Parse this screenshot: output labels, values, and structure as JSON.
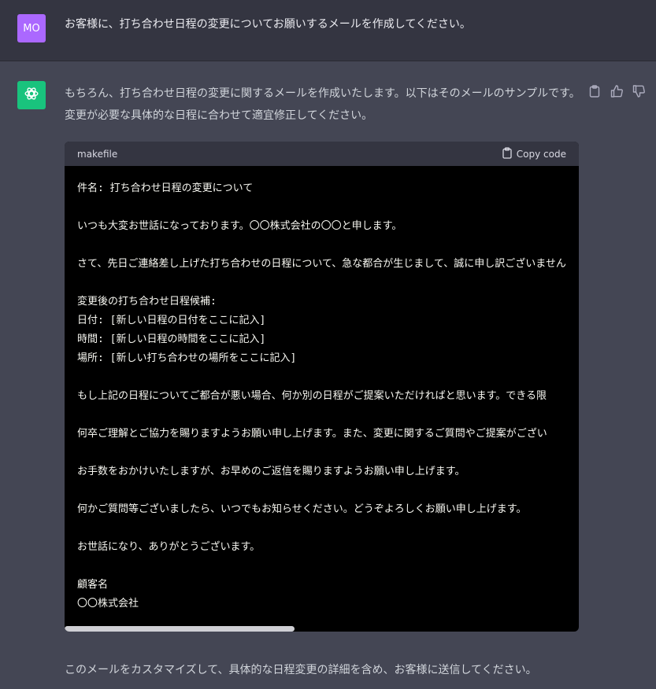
{
  "user": {
    "avatar_initials": "MO",
    "avatar_color": "#ab68ff",
    "message": "お客様に、打ち合わせ日程の変更についてお願いするメールを作成してください。"
  },
  "assistant": {
    "avatar_icon": "openai-logo-icon",
    "avatar_color": "#19c37d",
    "intro": "もちろん、打ち合わせ日程の変更に関するメールを作成いたします。以下はそのメールのサンプルです。変更が必要な具体的な日程に合わせて適宜修正してください。",
    "actions": [
      "clipboard-icon",
      "thumbs-up-icon",
      "thumbs-down-icon"
    ],
    "code_block": {
      "language": "makefile",
      "copy_label": "Copy code",
      "lines": [
        "件名: 打ち合わせ日程の変更について",
        "",
        "いつも大変お世話になっております。〇〇株式会社の〇〇と申します。",
        "",
        "さて、先日ご連絡差し上げた打ち合わせの日程について、急な都合が生じまして、誠に申し訳ございません",
        "",
        "変更後の打ち合わせ日程候補:",
        "日付: [新しい日程の日付をここに記入]",
        "時間: [新しい日程の時間をここに記入]",
        "場所: [新しい打ち合わせの場所をここに記入]",
        "",
        "もし上記の日程についてご都合が悪い場合、何か別の日程がご提案いただければと思います。できる限",
        "",
        "何卒ご理解とご協力を賜りますようお願い申し上げます。また、変更に関するご質問やご提案がござい",
        "",
        "お手数をおかけいたしますが、お早めのご返信を賜りますようお願い申し上げます。",
        "",
        "何かご質問等ございましたら、いつでもお知らせください。どうぞよろしくお願い申し上げます。",
        "",
        "お世話になり、ありがとうございます。",
        "",
        "顧客名",
        "〇〇株式会社"
      ]
    },
    "outro": "このメールをカスタマイズして、具体的な日程変更の詳細を含め、お客様に送信してください。"
  }
}
